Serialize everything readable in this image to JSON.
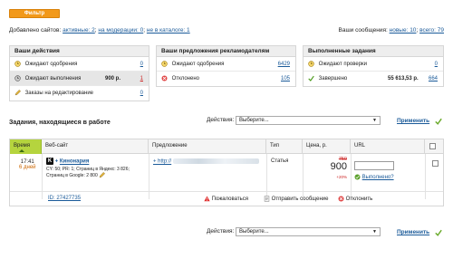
{
  "filter": {
    "label": "Фильтр"
  },
  "topline": {
    "prefix": "Добавлено сайтов:",
    "active_label": "активные: 2",
    "moderation_label": "на модерации: 0",
    "notcatalog_label": "не в каталоге: 1",
    "sep": ";",
    "msg_prefix": "Ваши сообщения:",
    "msg_new": "новые: 10",
    "msg_all": "всего: 79"
  },
  "box_actions": {
    "title": "Ваши действия",
    "rows": [
      {
        "label": "Ожидают одобрения",
        "mid": "",
        "value": "0"
      },
      {
        "label": "Ожидают выполнения",
        "mid": "900 р.",
        "value": "1"
      },
      {
        "label": "Заказы на редактирование",
        "mid": "",
        "value": "0"
      }
    ]
  },
  "box_offers": {
    "title": "Ваши предложения рекламодателям",
    "rows": [
      {
        "label": "Ожидают одобрения",
        "value": "6429"
      },
      {
        "label": "Отклонено",
        "value": "105"
      }
    ]
  },
  "box_done": {
    "title": "Выполненные задания",
    "rows": [
      {
        "label": "Ожидают проверки",
        "mid": "",
        "value": "0"
      },
      {
        "label": "Завершено",
        "mid": "55 613,53 р.",
        "value": "664"
      }
    ]
  },
  "section_title": "Задания, находящиеся в работе",
  "actions": {
    "label": "Действия:",
    "selected": "Выберите...",
    "apply": "Применить"
  },
  "table": {
    "headers": [
      "Время",
      "Веб-сайт",
      "Предложение",
      "Тип",
      "Цена, р.",
      "URL",
      ""
    ],
    "row": {
      "time": "17:41",
      "days": "6 дней",
      "badge": "K",
      "site_plus": "+",
      "site_name": "Кинонария",
      "stats1": "CY: 50; PR: 1; Страниц в Яндекс: 3 826;",
      "stats2": "Страниц в Google: 2 800",
      "offer_prefix": "+ http://",
      "type": "Статья",
      "price_old": "750",
      "price": "900",
      "percent": "+20%",
      "done_link": "Выполнено?",
      "id_link": "ID: 27427735",
      "complain": "Пожаловаться",
      "send_msg": "Отправить сообщение",
      "reject": "Отклонить"
    }
  },
  "bottom_actions": {
    "label": "Действия:",
    "selected": "Выберите...",
    "apply": "Применить"
  },
  "colors": {
    "accent": "#f2991a",
    "link": "#1a5a99",
    "green": "#b5d43e",
    "red": "#cc2222"
  }
}
